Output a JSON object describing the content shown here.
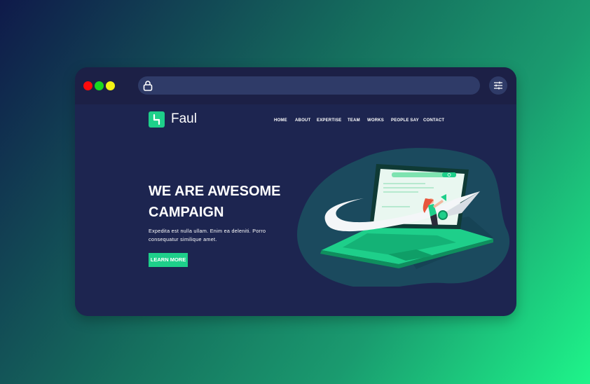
{
  "logo": {
    "name": "Faul"
  },
  "nav": {
    "items": [
      {
        "label": "HOME"
      },
      {
        "label": "ABOUT"
      },
      {
        "label": "EXPERTISE"
      },
      {
        "label": "TEAM"
      },
      {
        "label": "WORKS"
      },
      {
        "label": "PEOPLE SAY"
      },
      {
        "label": "CONTACT"
      }
    ]
  },
  "hero": {
    "headline_line1": "WE ARE AWESOME",
    "headline_line2": "CAMPAIGN",
    "body_line1": "Expedita est nulla ullam. Enim ea deleniti. Porro",
    "body_line2": "consequatur similique amet.",
    "cta_label": "LEARN MORE"
  },
  "colors": {
    "accent": "#1ecf8a",
    "page_background": "#1d2550",
    "titlebar": "#1c2046",
    "urlbar": "#2f3b68",
    "blob": "#1b4a5e"
  },
  "icons": {
    "window_controls": [
      "red-dot",
      "green-dot",
      "yellow-dot"
    ],
    "urlbar": "lock-icon",
    "browser_menu": "sliders-icon"
  }
}
